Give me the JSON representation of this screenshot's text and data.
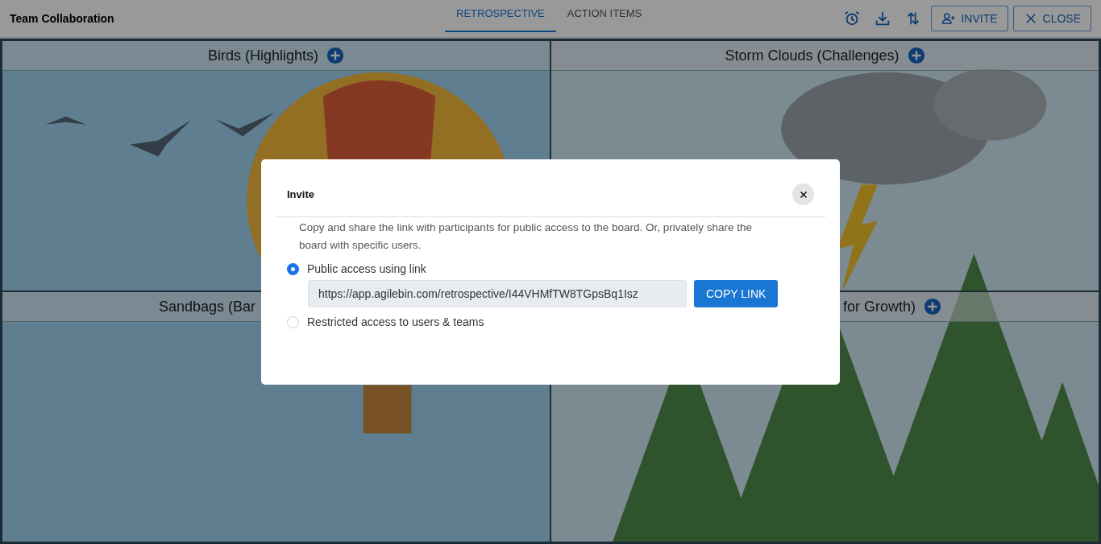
{
  "app": {
    "title": "Team Collaboration"
  },
  "tabs": [
    {
      "label": "RETROSPECTIVE",
      "selected": true
    },
    {
      "label": "ACTION ITEMS",
      "selected": false
    }
  ],
  "actions": [
    {
      "kind": "invite",
      "label": "INVITE"
    },
    {
      "kind": "close",
      "label": "CLOSE"
    }
  ],
  "board": {
    "sections": [
      {
        "title": "Birds (Highlights)"
      },
      {
        "title": "Storm Clouds (Challenges)"
      },
      {
        "title": "Sandbags (Bar"
      },
      {
        "title": "for Growth)"
      }
    ]
  },
  "dialog": {
    "title": "Invite",
    "description": "Copy and share the link with participants for public access to the board. Or, privately share the board with specific users.",
    "options": [
      {
        "label": "Public access using link",
        "selected": true
      },
      {
        "label": "Restricted access to users & teams",
        "selected": false
      }
    ],
    "link": {
      "value": "https://app.agilebin.com/retrospective/I44VHMfTW8TGpsBq1Isz"
    },
    "copy_button": "COPY LINK"
  }
}
